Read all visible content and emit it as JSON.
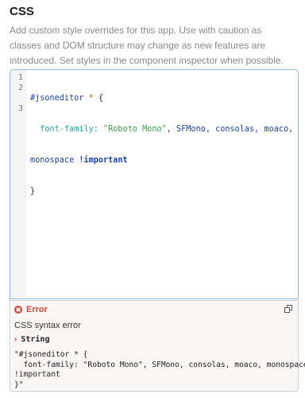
{
  "section": {
    "title": "CSS",
    "description": "Add custom style overrides for this app. Use with caution as classes and DOM structure may change as new features are introduced. Set styles in the component inspector when possible."
  },
  "editor": {
    "line_numbers": [
      "1",
      "2",
      "3"
    ],
    "code": {
      "selector": "#jsoneditor",
      "star": "*",
      "open_brace": "{",
      "property": "font-family:",
      "string": "\"Roboto Mono\"",
      "fonts": ", SFMono, consolas, moaco,",
      "wrap_font": "monospace",
      "important": "!important",
      "close_brace": "}"
    }
  },
  "error": {
    "title": "Error",
    "message": "CSS syntax error",
    "type_label": "String",
    "value_lines": [
      "\"#jsoneditor * {",
      "  font-family: \"Roboto Mono\", SFMono, consolas, moaco, monospace",
      "!important",
      "}\""
    ]
  },
  "icons": {
    "error": "error-circle-icon",
    "copy": "copy-icon",
    "expand": "chevron-right-icon"
  },
  "colors": {
    "error": "#c94e3a",
    "focus_border": "#8fb8ef"
  }
}
